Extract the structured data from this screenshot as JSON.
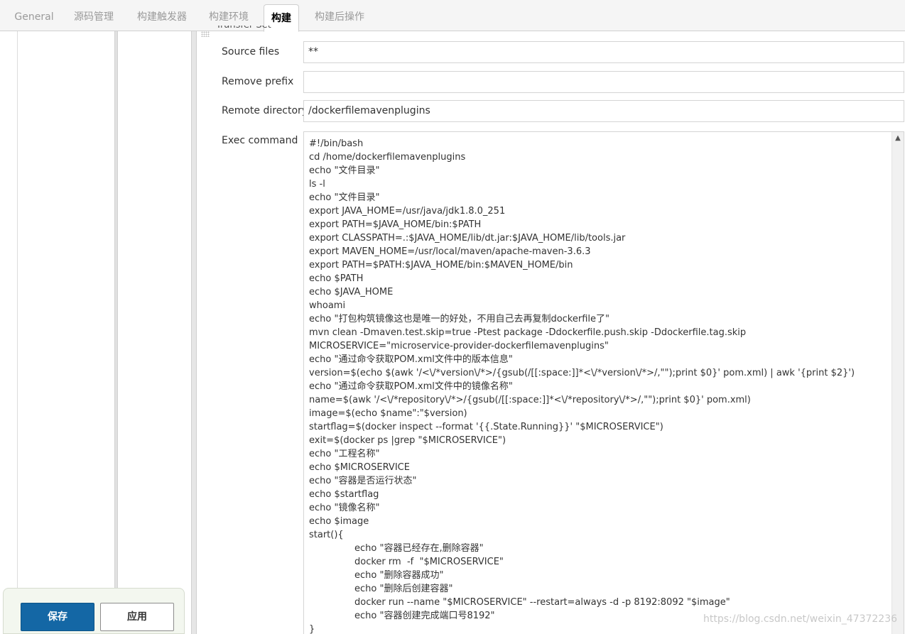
{
  "tabs": [
    {
      "label": "General",
      "active": false
    },
    {
      "label": "源码管理",
      "active": false
    },
    {
      "label": "构建触发器",
      "active": false
    },
    {
      "label": "构建环境",
      "active": false
    },
    {
      "label": "构建",
      "active": true
    },
    {
      "label": "构建后操作",
      "active": false
    }
  ],
  "section_label_cut": "Transfer Set",
  "form": {
    "source_files": {
      "label": "Source files",
      "value": "**"
    },
    "remove_prefix": {
      "label": "Remove prefix",
      "value": ""
    },
    "remote_directory": {
      "label": "Remote directory",
      "value": "/dockerfilemavenplugins"
    },
    "exec_command": {
      "label": "Exec command",
      "lines": [
        {
          "text": "#!/bin/bash",
          "indent": false
        },
        {
          "text": "cd /home/dockerfilemavenplugins",
          "indent": false
        },
        {
          "text": "echo \"文件目录\"",
          "indent": false
        },
        {
          "text": "ls -l",
          "indent": false
        },
        {
          "text": "echo \"文件目录\"",
          "indent": false
        },
        {
          "text": "export JAVA_HOME=/usr/java/jdk1.8.0_251",
          "indent": false
        },
        {
          "text": "export PATH=$JAVA_HOME/bin:$PATH",
          "indent": false
        },
        {
          "text": "export CLASSPATH=.:$JAVA_HOME/lib/dt.jar:$JAVA_HOME/lib/tools.jar",
          "indent": false
        },
        {
          "text": "export MAVEN_HOME=/usr/local/maven/apache-maven-3.6.3",
          "indent": false
        },
        {
          "text": "export PATH=$PATH:$JAVA_HOME/bin:$MAVEN_HOME/bin",
          "indent": false
        },
        {
          "text": "echo $PATH",
          "indent": false
        },
        {
          "text": "echo $JAVA_HOME",
          "indent": false
        },
        {
          "text": "whoami",
          "indent": false
        },
        {
          "text": "echo \"打包构筑镜像这也是唯一的好处，不用自己去再复制dockerfile了\"",
          "indent": false
        },
        {
          "text": "mvn clean -Dmaven.test.skip=true -Ptest package -Ddockerfile.push.skip -Ddockerfile.tag.skip",
          "indent": false
        },
        {
          "text": "MICROSERVICE=\"microservice-provider-dockerfilemavenplugins\"",
          "indent": false
        },
        {
          "text": "echo \"通过命令获取POM.xml文件中的版本信息\"",
          "indent": false
        },
        {
          "text": "version=$(echo $(awk '/<\\/*version\\/*>/{gsub(/[[:space:]]*<\\/*version\\/*>/,\"\");print $0}' pom.xml) | awk '{print $2}')",
          "indent": false
        },
        {
          "text": "echo \"通过命令获取POM.xml文件中的镜像名称\"",
          "indent": false
        },
        {
          "text": "name=$(awk '/<\\/*repository\\/*>/{gsub(/[[:space:]]*<\\/*repository\\/*>/,\"\");print $0}' pom.xml)",
          "indent": false
        },
        {
          "text": "image=$(echo $name\":\"$version)",
          "indent": false
        },
        {
          "text": "startflag=$(docker inspect --format '{{.State.Running}}' \"$MICROSERVICE\")",
          "indent": false
        },
        {
          "text": "exit=$(docker ps |grep \"$MICROSERVICE\")",
          "indent": false
        },
        {
          "text": "echo \"工程名称\"",
          "indent": false
        },
        {
          "text": "echo $MICROSERVICE",
          "indent": false
        },
        {
          "text": "echo \"容器是否运行状态\"",
          "indent": false
        },
        {
          "text": "echo $startflag",
          "indent": false
        },
        {
          "text": "echo \"镜像名称\"",
          "indent": false
        },
        {
          "text": "echo $image",
          "indent": false
        },
        {
          "text": "start(){",
          "indent": false
        },
        {
          "text": "echo \"容器已经存在,删除容器\"",
          "indent": true
        },
        {
          "text": "docker rm  -f  \"$MICROSERVICE\"",
          "indent": true
        },
        {
          "text": "echo \"删除容器成功\"",
          "indent": true
        },
        {
          "text": "echo \"删除后创建容器\"",
          "indent": true
        },
        {
          "text": "docker run --name \"$MICROSERVICE\" --restart=always -d -p 8192:8092 \"$image\"",
          "indent": true
        },
        {
          "text": "echo \"容器创建完成端口号8192\"",
          "indent": true
        },
        {
          "text": "}",
          "indent": false
        }
      ]
    }
  },
  "buttons": {
    "save": "保存",
    "apply": "应用"
  },
  "watermark": "https://blog.csdn.net/weixin_47372236"
}
